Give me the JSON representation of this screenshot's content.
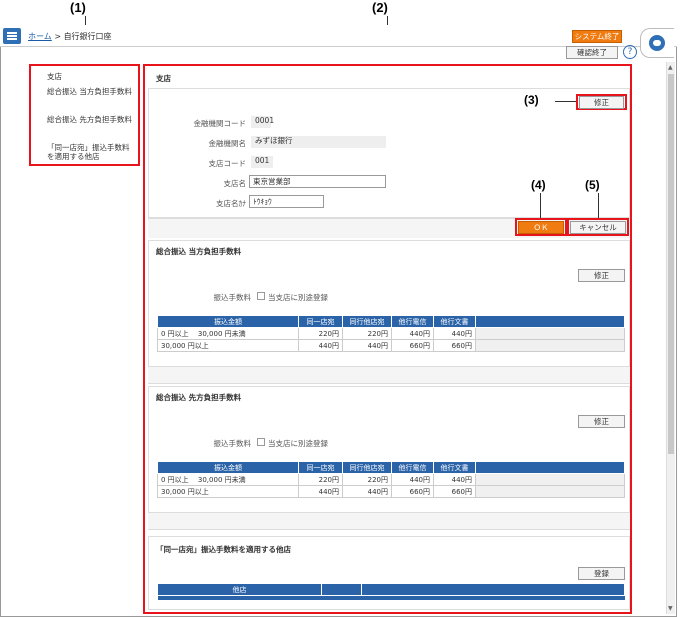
{
  "annotations": {
    "a1": "(1)",
    "a2": "(2)",
    "a3": "(3)",
    "a4": "(4)",
    "a5": "(5)"
  },
  "header": {
    "home_link": "ホーム",
    "separator": ">",
    "current": "自行銀行口座",
    "system_exit": "システム終了",
    "confirm_exit": "確認終了",
    "help": "?"
  },
  "sidebar": {
    "items": [
      "支店",
      "総合振込 当方負担手数料",
      "総合振込 先方負担手数料",
      "「同一店宛」振込手数料を適用する他店"
    ]
  },
  "branch": {
    "title": "支店",
    "edit_button": "修正",
    "fields": [
      {
        "label": "金融機関コード",
        "value": "0001"
      },
      {
        "label": "金融機関名",
        "value": "みずほ銀行"
      },
      {
        "label": "支店コード",
        "value": "001"
      },
      {
        "label": "支店名",
        "value": "東京営業部"
      },
      {
        "label": "支店名ｶﾅ",
        "value": "ﾄｳｷｮｳ"
      }
    ],
    "ok_button": "ＯＫ",
    "cancel_button": "キャンセル"
  },
  "fee_ours": {
    "title": "総合振込 当方負担手数料",
    "edit_button": "修正",
    "fee_label": "振込手数料",
    "checkbox_label": "当支店に別途登録",
    "headers": [
      "振込金額",
      "同一店宛",
      "同行他店宛",
      "他行電信",
      "他行文書"
    ],
    "rows": [
      [
        "0 円以上　 30,000 円未満",
        "220円",
        "220円",
        "440円",
        "440円"
      ],
      [
        "30,000 円以上",
        "440円",
        "440円",
        "660円",
        "660円"
      ]
    ]
  },
  "fee_theirs": {
    "title": "総合振込 先方負担手数料",
    "edit_button": "修正",
    "fee_label": "振込手数料",
    "checkbox_label": "当支店に別途登録",
    "headers": [
      "振込金額",
      "同一店宛",
      "同行他店宛",
      "他行電信",
      "他行文書"
    ],
    "rows": [
      [
        "0 円以上　 30,000 円未満",
        "220円",
        "220円",
        "440円",
        "440円"
      ],
      [
        "30,000 円以上",
        "440円",
        "440円",
        "660円",
        "660円"
      ]
    ]
  },
  "other_branch": {
    "title": "「同一店宛」振込手数料を適用する他店",
    "register_button": "登録",
    "headers": [
      "他店",
      ""
    ]
  },
  "colors": {
    "accent_orange": "#f07b10",
    "highlight_red": "#e8141c",
    "header_blue": "#2a63a8"
  }
}
